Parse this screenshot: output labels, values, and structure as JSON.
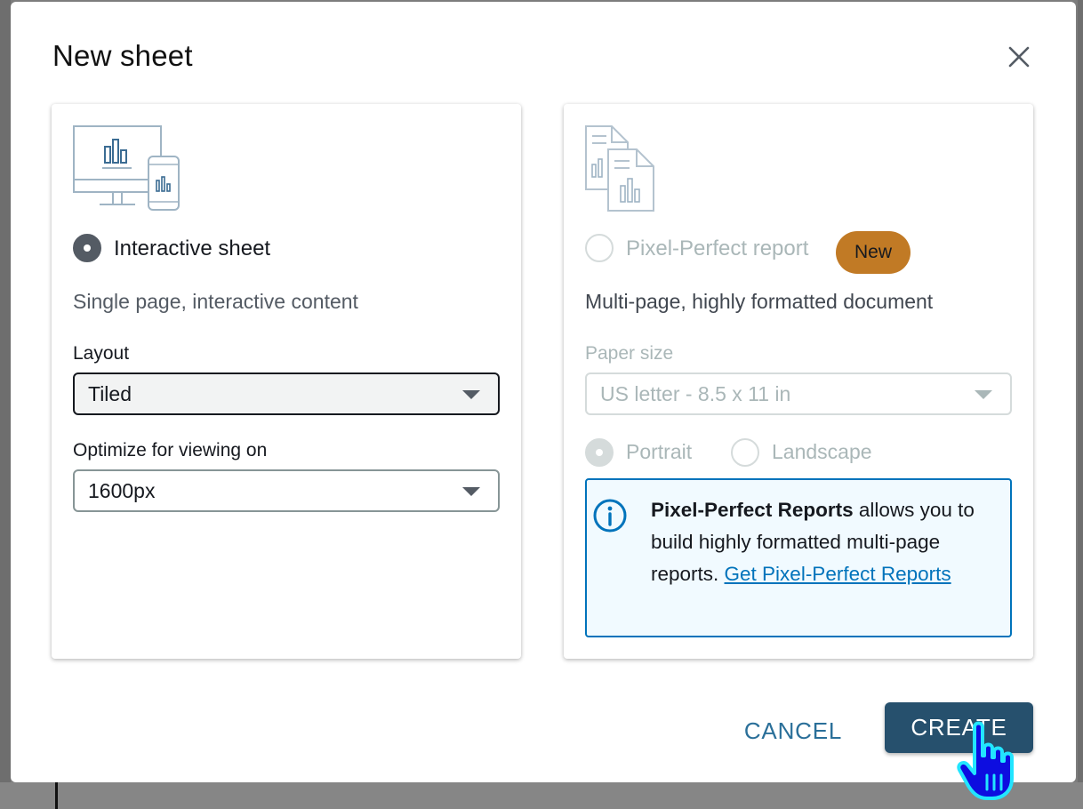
{
  "modal": {
    "title": "New sheet",
    "close_icon": "close-icon"
  },
  "interactive": {
    "illustration": "desktop-mobile-chart-icon",
    "title": "Interactive sheet",
    "description": "Single page, interactive content",
    "layout_label": "Layout",
    "layout_value": "Tiled",
    "viewing_label": "Optimize for viewing on",
    "viewing_value": "1600px",
    "selected": true
  },
  "pixel_perfect": {
    "illustration": "multi-page-report-icon",
    "title": "Pixel-Perfect report",
    "badge": "New",
    "description": "Multi-page, highly formatted document",
    "paper_label": "Paper size",
    "paper_value": "US letter - 8.5 x 11 in",
    "orientation_portrait": "Portrait",
    "orientation_landscape": "Landscape",
    "info_bold": "Pixel-Perfect Reports",
    "info_text": " allows you to build highly formatted multi-page reports. ",
    "info_link": "Get Pixel-Perfect Reports",
    "selected": false
  },
  "footer": {
    "cancel_label": "CANCEL",
    "create_label": "CREATE"
  },
  "colors": {
    "primary_button": "#26506d",
    "link": "#0073bb",
    "badge": "#c17a25",
    "info_bg": "#f1faff"
  }
}
